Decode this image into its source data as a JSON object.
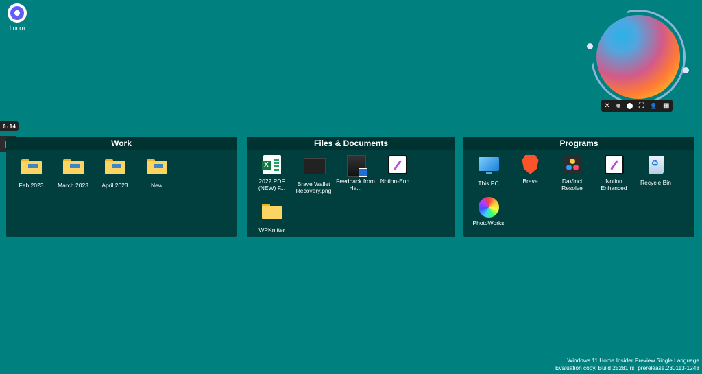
{
  "desktop": {
    "loom_label": "Loom"
  },
  "recorder": {
    "timer": "0:14"
  },
  "camera_toolbar": {
    "close_glyph": "✕",
    "expand_glyph": "⛶",
    "person_glyph": "👤",
    "calendar_glyph": "▦"
  },
  "fences": [
    {
      "title": "Work",
      "items": [
        {
          "label": "Feb 2023",
          "icon": "folder-icon"
        },
        {
          "label": "March 2023",
          "icon": "folder-icon"
        },
        {
          "label": "April 2023",
          "icon": "folder-icon"
        },
        {
          "label": "New",
          "icon": "folder-icon"
        }
      ]
    },
    {
      "title": "Files & Documents",
      "items": [
        {
          "label": "2022 PDF (NEW) F...",
          "icon": "excel-icon"
        },
        {
          "label": "Brave Wallet Recovery.png",
          "icon": "image-icon"
        },
        {
          "label": "Feedback from Ha...",
          "icon": "image-shortcut-icon"
        },
        {
          "label": "Notion-Enh...",
          "icon": "notion-icon"
        },
        {
          "label": "WPKnitter",
          "icon": "folder-icon"
        }
      ]
    },
    {
      "title": "Programs",
      "items": [
        {
          "label": "This PC",
          "icon": "monitor-icon"
        },
        {
          "label": "Brave",
          "icon": "brave-icon"
        },
        {
          "label": "DaVinci Resolve",
          "icon": "davinci-icon"
        },
        {
          "label": "Notion Enhanced",
          "icon": "notion-icon"
        },
        {
          "label": "Recycle Bin",
          "icon": "recycle-bin-icon"
        },
        {
          "label": "PhotoWorks",
          "icon": "photoworks-icon"
        }
      ]
    }
  ],
  "watermark": {
    "line1": "Windows 11 Home Insider Preview Single Language",
    "line2": "Evaluation copy. Build 25281.rs_prerelease.230113-1248"
  },
  "colors": {
    "desktop": "#00807f",
    "fence_body": "#003f3e",
    "fence_header": "#003232",
    "record": "#f25a3c"
  }
}
